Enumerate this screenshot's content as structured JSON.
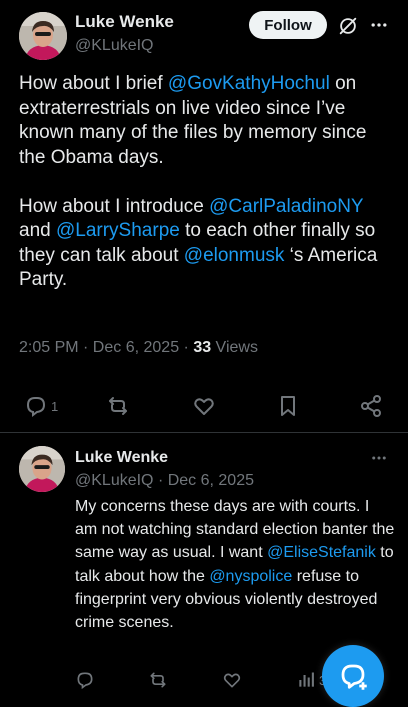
{
  "main_post": {
    "author_name": "Luke Wenke",
    "author_handle": "@KLukeIQ",
    "follow_label": "Follow",
    "paragraphs": [
      [
        {
          "t": "How about I brief ",
          "m": false
        },
        {
          "t": "@GovKathyHochul",
          "m": true
        },
        {
          "t": " on extraterrestrials on live video since I’ve known many of the files by memory since the Obama days.",
          "m": false
        }
      ],
      [
        {
          "t": "How about I introduce ",
          "m": false
        },
        {
          "t": "@CarlPaladinoNY",
          "m": true
        },
        {
          "t": " and ",
          "m": false
        },
        {
          "t": "@LarrySharpe",
          "m": true
        },
        {
          "t": " to each other finally so they can talk about ",
          "m": false
        },
        {
          "t": "@elonmusk",
          "m": true
        },
        {
          "t": " ‘s America Party.",
          "m": false
        }
      ]
    ],
    "timestamp": "2:05 PM · Dec 6, 2025 · ",
    "views_count": "33",
    "views_label": " Views",
    "reply_count": "1"
  },
  "reply_post": {
    "author_name": "Luke Wenke",
    "author_handle": "@KLukeIQ · Dec 6, 2025",
    "segments": [
      {
        "t": "My concerns these days are with courts. I am not watching standard election banter the same way as usual.  I want ",
        "m": false
      },
      {
        "t": "@EliseStefanik",
        "m": true
      },
      {
        "t": " to talk about how the ",
        "m": false
      },
      {
        "t": "@nyspolice",
        "m": true
      },
      {
        "t": " refuse to fingerprint very obvious violently destroyed crime scenes.",
        "m": false
      }
    ],
    "views_count": "37"
  },
  "colors": {
    "background": "#000000",
    "text": "#e7e9ea",
    "muted": "#71767b",
    "accent": "#1d9bf0",
    "divider": "#2f3336"
  },
  "icons": [
    "grok-icon",
    "more-icon",
    "reply-icon",
    "repost-icon",
    "like-icon",
    "bookmark-icon",
    "share-icon",
    "views-icon",
    "compose-icon"
  ]
}
